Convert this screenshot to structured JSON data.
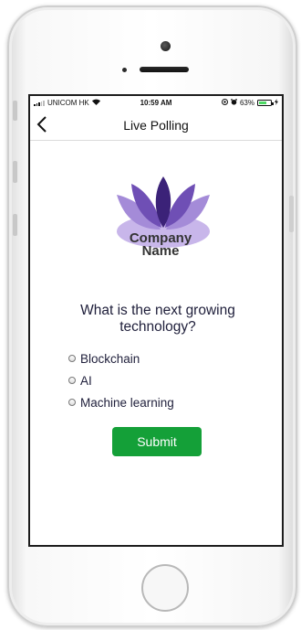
{
  "status_bar": {
    "carrier": "UNICOM HK",
    "time": "10:59 AM",
    "battery": "63%",
    "battery_level": 0.63
  },
  "nav": {
    "title": "Live Polling"
  },
  "logo": {
    "line1": "Company",
    "line2": "Name",
    "colors": [
      "#3b2278",
      "#6f4fb5",
      "#a48bd8",
      "#c8b6ea"
    ]
  },
  "poll": {
    "question": "What is the next growing technology?",
    "options": [
      {
        "label": "Blockchain"
      },
      {
        "label": "AI"
      },
      {
        "label": "Machine learning"
      }
    ],
    "submit_label": "Submit"
  },
  "colors": {
    "submit": "#14a038",
    "text": "#1e1e3a"
  }
}
